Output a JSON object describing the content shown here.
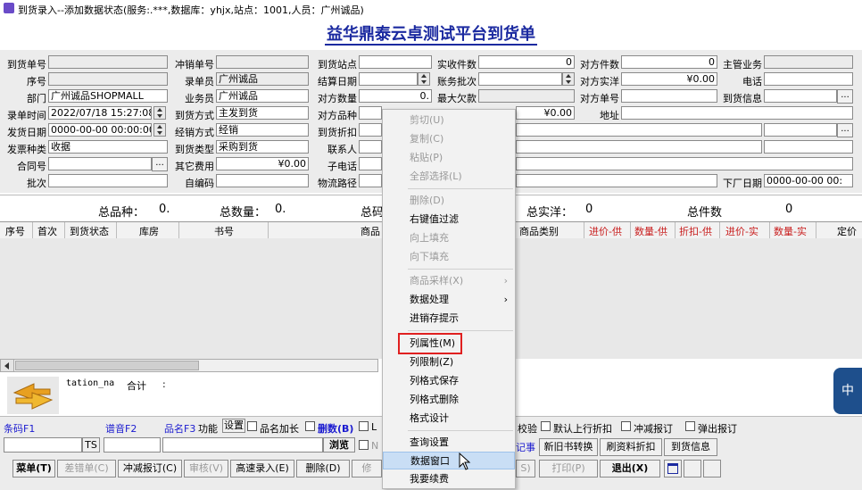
{
  "window": {
    "title": "到货录入--添加数据状态(服务:.***,数据库：yhjx,站点：1001,人员：广州诚品)"
  },
  "page": {
    "heading": "益华鼎泰云卓测试平台到货单"
  },
  "form": {
    "l_daohuo_no": "到货单号",
    "l_chongxiao_no": "冲销单号",
    "l_daohuo_site": "到货站点",
    "l_shoujian": "实收件数",
    "v_shoujian": "0",
    "l_duifang_jianshu": "对方件数",
    "v_duifang_jianshu": "0",
    "l_zhuguan": "主管业务",
    "l_xuhao": "序号",
    "l_ludanyuan": "录单员",
    "v_ludanyuan": "广州诚品",
    "l_jiesuan_date": "结算日期",
    "l_zhangwu_pici": "账务批次",
    "l_duifang_shiyang": "对方实洋",
    "v_duifang_shiyang": "¥0.00",
    "l_dianhua": "电话",
    "l_bumen": "部门",
    "v_bumen": "广州诚品SHOPMALL",
    "l_yewuyuan": "业务员",
    "v_yewuyuan": "广州诚品",
    "l_duifang_shuliang": "对方数量",
    "v_duifang_shuliang": "0.",
    "l_zuida_qiankuan": "最大欠款",
    "l_duifang_danhao": "对方单号",
    "l_daohuo_info": "到货信息",
    "l_ludan_time": "录单时间",
    "v_ludan_time": "2022/07/18 15:27:08",
    "l_daohuo_fangshi": "到货方式",
    "v_daohuo_fangshi": "主发到货",
    "l_duifang_pinzhong": "对方品种",
    "v_credit": "¥0.00",
    "l_dizhi": "地址",
    "l_fahuo_date": "发货日期",
    "v_fahuo_date": "0000-00-00 00:00:00",
    "l_jingxiao_fangshi": "经销方式",
    "v_jingxiao_fangshi": "经销",
    "l_daohuo_zhekou": "到货折扣",
    "l_fapiao_type": "发票种类",
    "v_fapiao_type": "收据",
    "l_daohuo_type": "到货类型",
    "v_daohuo_type": "采购到货",
    "l_lianxiren": "联系人",
    "l_hetong": "合同号",
    "l_qita_feiyong": "其它费用",
    "v_qita_feiyong": "¥0.00",
    "l_zidianhua": "子电话",
    "l_pici": "批次",
    "l_zibianma": "自编码",
    "l_wuliu": "物流路径",
    "l_xiachang_date": "下厂日期",
    "v_xiachang_date": "0000-00-00 00:"
  },
  "summary": {
    "l_total_kinds": "总品种：",
    "v_total_kinds": "0.",
    "l_total_qty": "总数量：",
    "v_total_qty": "0.",
    "l_total_partial": "总码",
    "l_total_real": "总实洋：",
    "v_total_real": "0",
    "l_total_pieces": "总件数",
    "v_total_pieces": "0"
  },
  "grid": {
    "columns": [
      "序号",
      "首次",
      "到货状态",
      "库房",
      "书号",
      "商品",
      "商品类别",
      "进价-供",
      "数量-供",
      "折扣-供",
      "进价-实",
      "数量-实",
      "定价"
    ]
  },
  "info": {
    "station": "tation_na",
    "total": "合计",
    "colon": ":"
  },
  "bottom": {
    "l_tiaoma": "条码F1",
    "l_yinpu": "谱音F2",
    "l_pinming": "品名F3",
    "b_gongneng": "功能",
    "b_shezhi": "设置",
    "l_pinming_jiachang": "品名加长",
    "l_shanshu": "删数(B)",
    "l_l": "L",
    "l_n": "N",
    "l_jiaoyan": "校验",
    "l_moren": "默认上行折扣",
    "l_chongjian": "冲减报订",
    "l_tanchu": "弹出报订",
    "ts": "TS",
    "b_liulan": "浏览",
    "l_jishi": "记事",
    "b_xinjiu": "新旧书转换",
    "b_shua": "刷资料折扣",
    "b_daohuo_info": "到货信息",
    "b_caidan": "菜单(T)",
    "b_chacuo": "差错单(C)",
    "b_chongjian": "冲减报订(C)",
    "b_shenhe": "审核(V)",
    "b_gaosu": "高速录入(E)",
    "b_shanchu": "删除(D)",
    "b_xiu": "修",
    "b_s": "S)",
    "b_dayin": "打印(P)",
    "b_tuichu": "退出(X)"
  },
  "context_menu": {
    "items": [
      "剪切(U)",
      "复制(C)",
      "粘贴(P)",
      "全部选择(L)",
      "删除(D)",
      "右键值过滤",
      "向上填充",
      "向下填充",
      "商品采样(X)",
      "数据处理",
      "进销存提示",
      "列属性(M)",
      "列限制(Z)",
      "列格式保存",
      "列格式删除",
      "格式设计",
      "查询设置",
      "数据窗口",
      "我要续费"
    ],
    "sub_arrow": "›"
  },
  "side_tab": "中",
  "colors": {
    "accent": "#1b2aa0",
    "highlight_box": "#e02020",
    "menu_highlight": "#c9def5"
  }
}
